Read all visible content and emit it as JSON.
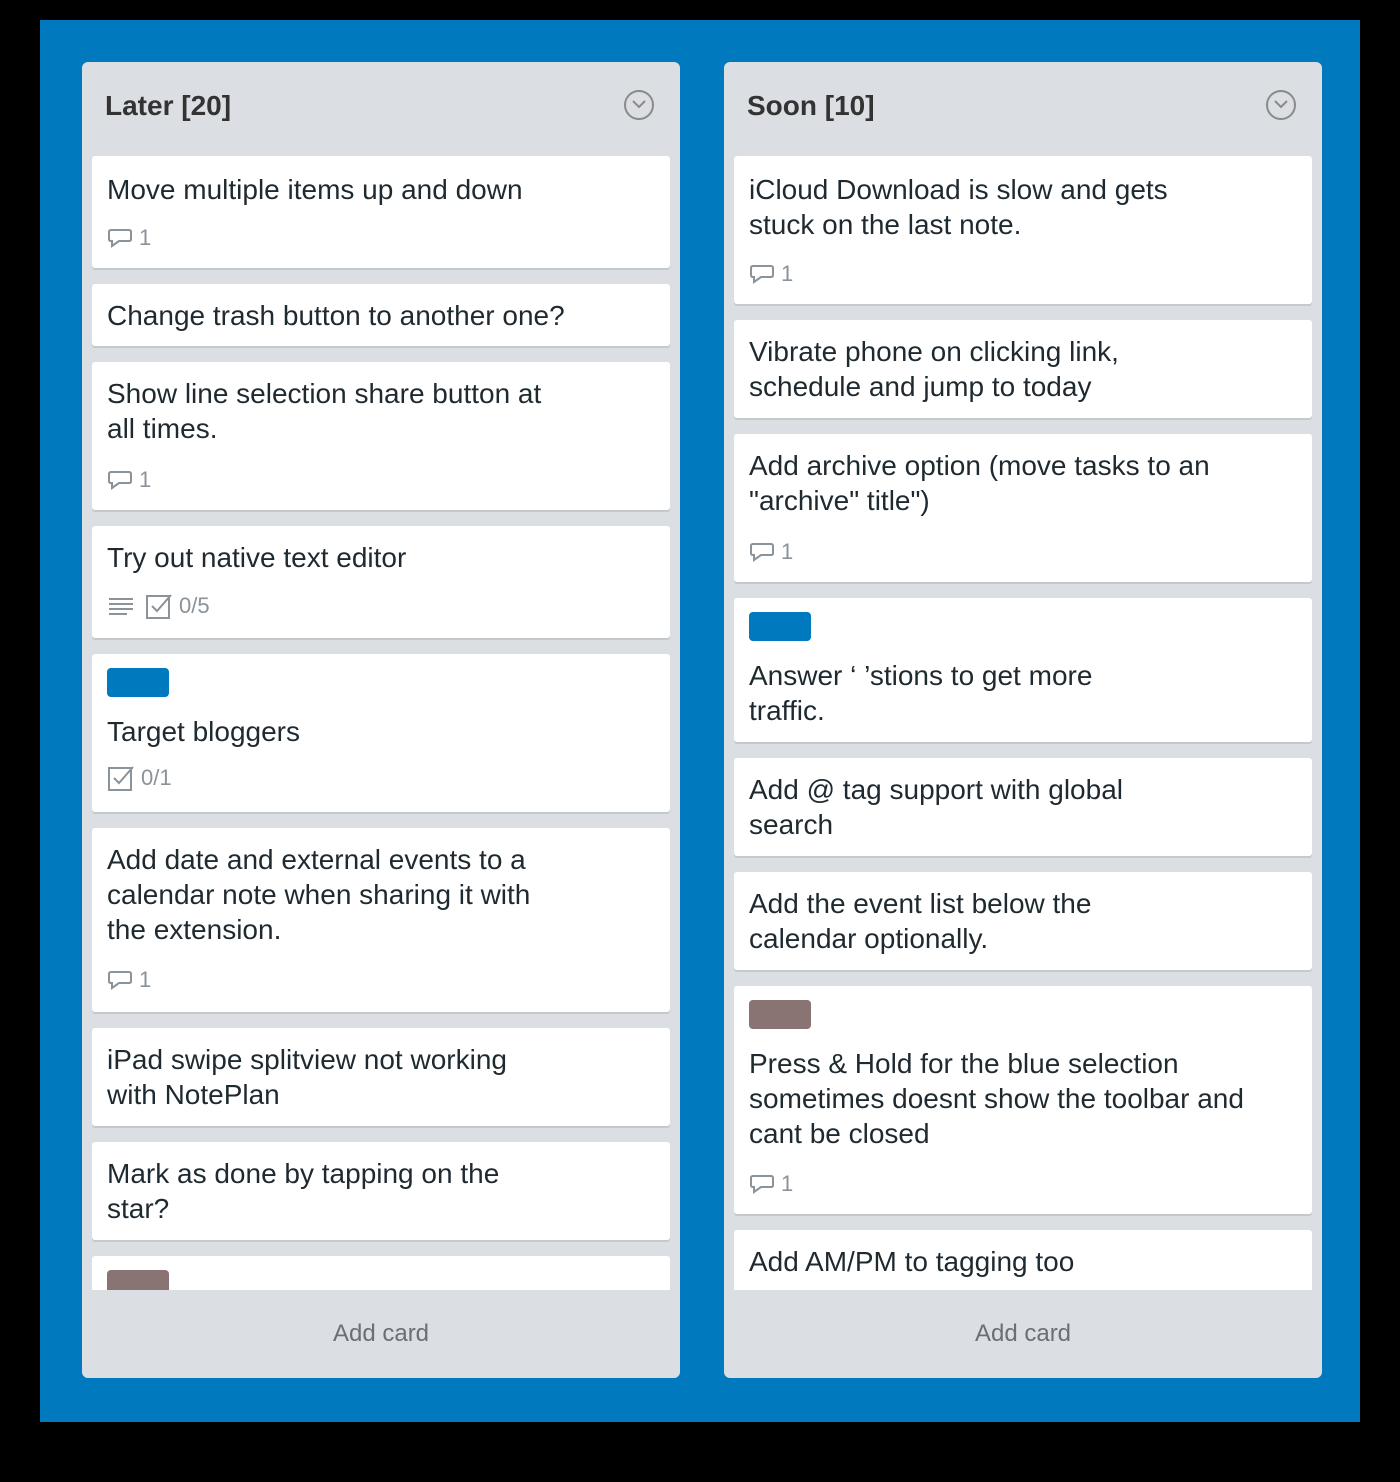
{
  "colors": {
    "board": "#0079bf",
    "label_blue": "#0079bf",
    "label_brown": "#8a7373"
  },
  "lists": [
    {
      "title": "Later [20]",
      "add_card": "Add card",
      "cards": [
        {
          "text": "Move multiple items up and down",
          "comments": "1"
        },
        {
          "text": "Change trash button to another one?"
        },
        {
          "text": "Show line selection share button at\nall times.",
          "comments": "1"
        },
        {
          "text": "Try out native text editor",
          "checklist": "0/5",
          "description": true
        },
        {
          "label": "blue",
          "text": "Target bloggers",
          "checklist": "0/1"
        },
        {
          "text": "Add date and external events to a\ncalendar note when sharing it with\nthe extension.",
          "comments": "1"
        },
        {
          "text": "iPad swipe splitview not working\nwith NotePlan"
        },
        {
          "text": "Mark as done by tapping on the\nstar?"
        },
        {
          "label": "brown",
          "text": ""
        }
      ]
    },
    {
      "title": "Soon [10]",
      "add_card": "Add card",
      "cards": [
        {
          "text": "iCloud Download is slow and gets\nstuck on the last note.",
          "comments": "1"
        },
        {
          "text": "Vibrate phone on clicking link,\nschedule and jump to today"
        },
        {
          "text": "Add archive option (move tasks to an\n\"archive\" title\")",
          "comments": "1"
        },
        {
          "label": "blue",
          "text": "Answer ‘                  ’stions to get more\ntraffic."
        },
        {
          "text": "Add @ tag support with global\nsearch"
        },
        {
          "text": "Add the event list below the\ncalendar optionally."
        },
        {
          "label": "brown",
          "text": "Press & Hold for the blue selection\nsometimes doesnt show the toolbar and\ncant be closed",
          "comments": "1"
        },
        {
          "text": "Add AM/PM to tagging too"
        }
      ]
    }
  ]
}
